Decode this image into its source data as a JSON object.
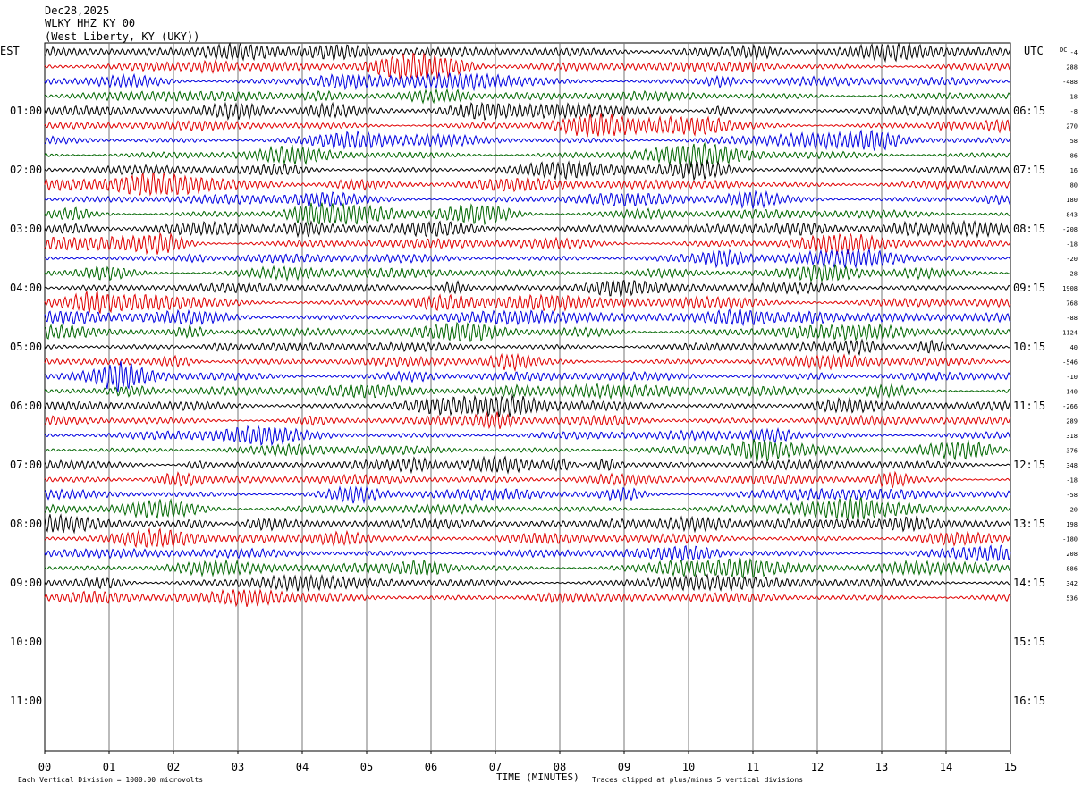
{
  "header": {
    "date": "Dec28,2025",
    "station": "WLKY HHZ KY 00",
    "location": "(West Liberty, KY (UKY))"
  },
  "labels": {
    "left_zone": "EST",
    "right_zone": "UTC",
    "dc_header": "DC"
  },
  "footer": {
    "scale_note": "Each Vertical Division = 1000.00 microvolts",
    "xlabel": "TIME (MINUTES)",
    "clip_note": "Traces clipped at plus/minus 5 vertical divisions"
  },
  "chart_data": {
    "type": "line",
    "x_range": [
      0,
      15
    ],
    "x_ticks": [
      "00",
      "01",
      "02",
      "03",
      "04",
      "05",
      "06",
      "07",
      "08",
      "09",
      "10",
      "11",
      "12",
      "13",
      "14",
      "15"
    ],
    "grid": "vertical lines at each minute",
    "trace_colors": [
      "#000000",
      "#e00000",
      "#0000e0",
      "#006600"
    ],
    "traces_recorded": 38,
    "rows_total": 48,
    "rows_per_hour": 4,
    "est_hour_labels": [
      "01:00",
      "02:00",
      "03:00",
      "04:00",
      "05:00",
      "06:00",
      "07:00",
      "08:00",
      "09:00",
      "10:00",
      "11:00"
    ],
    "utc_hour_labels": [
      "06:15",
      "07:15",
      "08:15",
      "09:15",
      "10:15",
      "11:15",
      "12:15",
      "13:15",
      "14:15",
      "15:15",
      "16:15"
    ],
    "dc_offsets": [
      "-4",
      "288",
      "-488",
      "-18",
      "-8",
      "270",
      "58",
      "86",
      "16",
      "80",
      "180",
      "843",
      "-208",
      "-18",
      "-20",
      "-28",
      "1908",
      "768",
      "-88",
      "1124",
      "40",
      "-546",
      "-10",
      "140",
      "-266",
      "289",
      "318",
      "-376",
      "348",
      "-18",
      "-58",
      "20",
      "198",
      "-180",
      "208",
      "886",
      "342",
      "536"
    ]
  }
}
